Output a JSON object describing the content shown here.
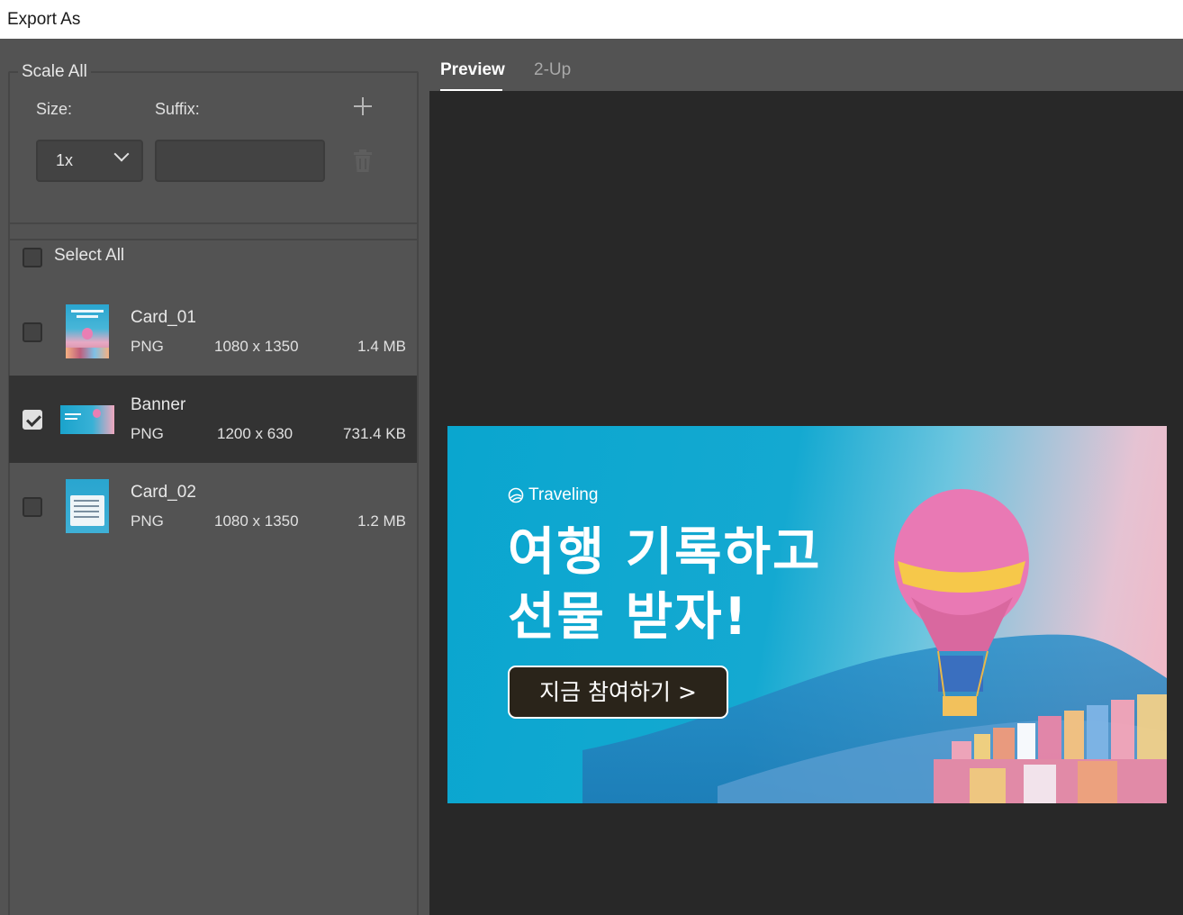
{
  "window": {
    "title": "Export As"
  },
  "scale_all": {
    "legend": "Scale All",
    "size_label": "Size:",
    "suffix_label": "Suffix:",
    "size_value": "1x",
    "suffix_value": "",
    "add_icon": "plus-icon",
    "delete_icon": "trash-icon"
  },
  "assets": {
    "select_all_label": "Select All",
    "select_all_checked": false,
    "items": [
      {
        "name": "Card_01",
        "format": "PNG",
        "dimensions": "1080 x 1350",
        "size": "1.4 MB",
        "checked": false
      },
      {
        "name": "Banner",
        "format": "PNG",
        "dimensions": "1200 x 630",
        "size": "731.4 KB",
        "checked": true
      },
      {
        "name": "Card_02",
        "format": "PNG",
        "dimensions": "1080 x 1350",
        "size": "1.2 MB",
        "checked": false
      }
    ]
  },
  "preview": {
    "tabs": [
      {
        "label": "Preview",
        "active": true
      },
      {
        "label": "2-Up",
        "active": false
      }
    ],
    "banner": {
      "brand": "Traveling",
      "headline_line1": "여행 기록하고",
      "headline_line2": "선물 받자!",
      "cta": "지금 참여하기 >"
    }
  },
  "colors": {
    "panel": "#535353",
    "canvas": "#282828",
    "selected_row": "#333333",
    "banner_blue": "#0aa6cf",
    "cta_bg": "#2a241a"
  }
}
